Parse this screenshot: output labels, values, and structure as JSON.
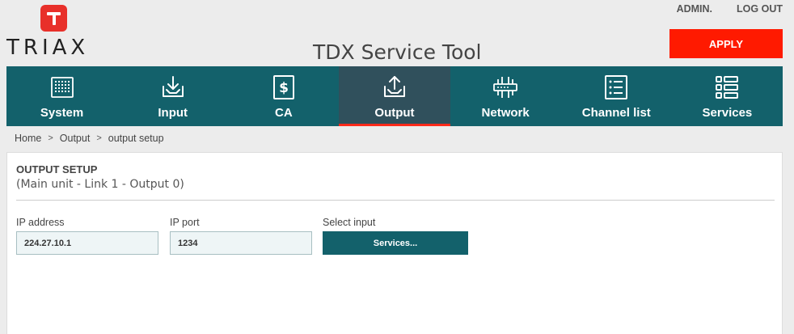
{
  "header": {
    "brand": "TRIAX",
    "app_title": "TDX Service Tool",
    "admin_label": "ADMIN.",
    "logout_label": "LOG OUT",
    "apply_label": "APPLY"
  },
  "nav": {
    "items": [
      {
        "label": "System",
        "icon": "system-icon"
      },
      {
        "label": "Input",
        "icon": "input-icon"
      },
      {
        "label": "CA",
        "icon": "ca-icon"
      },
      {
        "label": "Output",
        "icon": "output-icon",
        "active": true
      },
      {
        "label": "Network",
        "icon": "network-icon"
      },
      {
        "label": "Channel list",
        "icon": "channel-list-icon"
      },
      {
        "label": "Services",
        "icon": "services-icon"
      }
    ]
  },
  "breadcrumb": {
    "items": [
      "Home",
      "Output",
      "output setup"
    ],
    "separator": ">"
  },
  "panel": {
    "title": "OUTPUT SETUP",
    "subtitle": "(Main unit - Link 1 - Output 0)",
    "ip_address_label": "IP address",
    "ip_address_value": "224.27.10.1",
    "ip_port_label": "IP port",
    "ip_port_value": "1234",
    "select_input_label": "Select input",
    "services_button_label": "Services..."
  },
  "colors": {
    "nav_bg": "#13616b",
    "nav_active_bg": "#30505c",
    "accent_red": "#ff1a00",
    "logo_red": "#e8302a"
  }
}
